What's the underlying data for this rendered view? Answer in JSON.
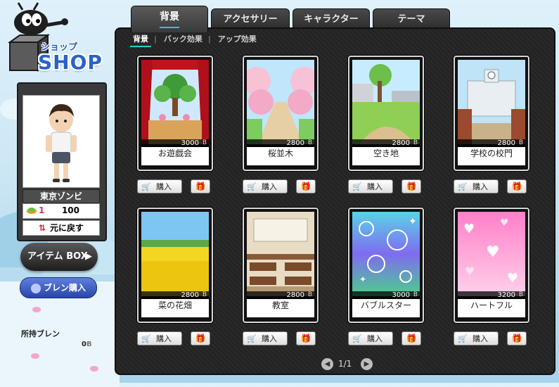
{
  "logo": {
    "jp": "ショップ",
    "en": "SHOP"
  },
  "tabs": [
    {
      "label": "背景",
      "active": true
    },
    {
      "label": "アクセサリー",
      "active": false
    },
    {
      "label": "キャラクター",
      "active": false
    },
    {
      "label": "テーマ",
      "active": false
    }
  ],
  "subtabs": [
    {
      "label": "背景",
      "active": true
    },
    {
      "label": "バック効果",
      "active": false
    },
    {
      "label": "アップ効果",
      "active": false
    }
  ],
  "profile": {
    "name": "東京ゾンビ",
    "currency_prefix": "1",
    "currency_amount": "100",
    "reset_label": "元に戻す"
  },
  "buttons": {
    "item_box": "アイテム BOX",
    "bren_buy": "ブレン購入",
    "buy": "購入"
  },
  "owned": {
    "label": "所持ブレン",
    "value": "0"
  },
  "items": [
    {
      "name": "お遊戯会",
      "price": "3000"
    },
    {
      "name": "桜並木",
      "price": "2800"
    },
    {
      "name": "空き地",
      "price": "2800"
    },
    {
      "name": "学校の校門",
      "price": "2800"
    },
    {
      "name": "菜の花畑",
      "price": "2800"
    },
    {
      "name": "教室",
      "price": "2800"
    },
    {
      "name": "バブルスター",
      "price": "3000"
    },
    {
      "name": "ハートフル",
      "price": "3200"
    }
  ],
  "pager": {
    "text": "1/1"
  },
  "icons": {
    "cart": "cart-icon",
    "gift": "gift-icon",
    "bren": "bren-coin-icon",
    "prev": "prev-page-icon",
    "next": "next-page-icon",
    "reset": "reset-icon"
  },
  "colors": {
    "accent": "#1cd2c8",
    "panel": "#232323",
    "bren_button": "#2846a8"
  }
}
